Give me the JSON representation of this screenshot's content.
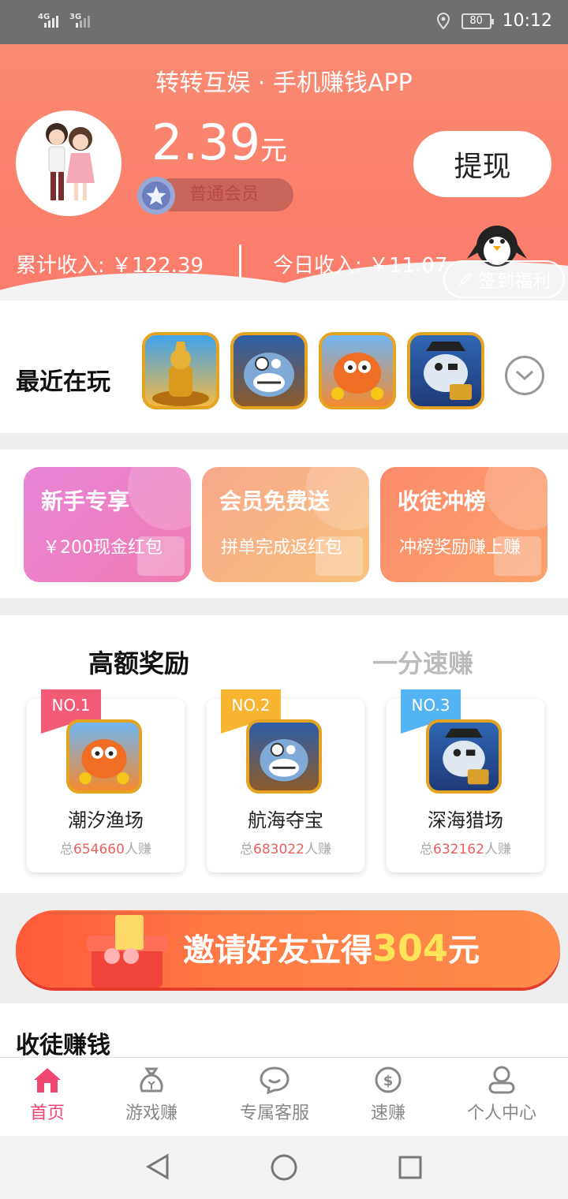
{
  "status_bar": {
    "signal_1": "4G",
    "signal_2": "3G",
    "battery": "80",
    "time": "10:12"
  },
  "header": {
    "app_title": "转转互娱 · 手机赚钱APP",
    "balance": "2.39",
    "balance_unit": "元",
    "member_level": "普通会员",
    "withdraw_label": "提现",
    "total_income": "累计收入: ￥122.39",
    "today_income": "今日收入: ￥11.07",
    "signin_label": "签到福利"
  },
  "recent": {
    "label": "最近在玩",
    "games": [
      "golden-statue",
      "shark-captain",
      "fish-king",
      "pirate-shark"
    ]
  },
  "promos": [
    {
      "title": "新手专享",
      "subtitle": "￥200现金红包",
      "color_start": "#e885d8",
      "color_end": "#f07cb0"
    },
    {
      "title": "会员免费送",
      "subtitle": "拼单完成返红包",
      "color_start": "#f7a88a",
      "color_end": "#f9c27e"
    },
    {
      "title": "收徒冲榜",
      "subtitle": "冲榜奖励赚上赚",
      "color_start": "#fb8a6c",
      "color_end": "#fba36c"
    }
  ],
  "ranking": {
    "tab_active": "高额奖励",
    "tab_inactive": "一分速赚",
    "items": [
      {
        "rank": "NO.1",
        "name": "潮汐渔场",
        "prefix": "总",
        "count": "654660",
        "suffix": "人赚",
        "ribbon": "#f25a76"
      },
      {
        "rank": "NO.2",
        "name": "航海夺宝",
        "prefix": "总",
        "count": "683022",
        "suffix": "人赚",
        "ribbon": "#f7b531"
      },
      {
        "rank": "NO.3",
        "name": "深海猎场",
        "prefix": "总",
        "count": "632162",
        "suffix": "人赚",
        "ribbon": "#54b3f2"
      }
    ]
  },
  "invite": {
    "text": "邀请好友立得",
    "amount": "304",
    "unit": "元"
  },
  "section": {
    "title": "收徒赚钱"
  },
  "nav": [
    {
      "label": "首页",
      "icon": "home-icon",
      "active": true
    },
    {
      "label": "游戏赚",
      "icon": "money-bag-icon",
      "active": false
    },
    {
      "label": "专属客服",
      "icon": "chat-icon",
      "active": false
    },
    {
      "label": "速赚",
      "icon": "dollar-icon",
      "active": false
    },
    {
      "label": "个人中心",
      "icon": "user-icon",
      "active": false
    }
  ],
  "colors": {
    "accent": "#f04772",
    "header": "#fb806c"
  }
}
